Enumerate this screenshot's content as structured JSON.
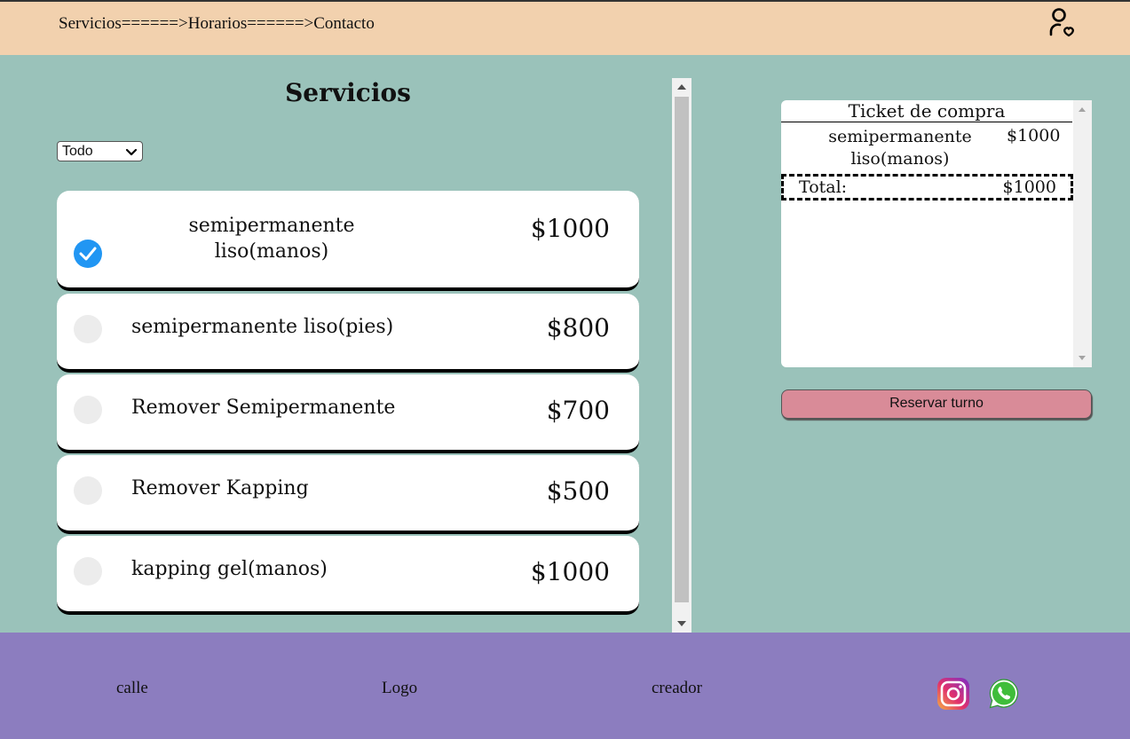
{
  "nav": {
    "items": [
      "Servicios",
      "======>",
      "Horarios",
      "======>",
      "Contacto"
    ]
  },
  "main": {
    "title": "Servicios",
    "filter": {
      "selected": "Todo"
    },
    "services": [
      {
        "name_line1": "semipermanente",
        "name_line2": "liso(manos)",
        "price": "$1000",
        "checked": true
      },
      {
        "name": "semipermanente liso(pies)",
        "price": "$800",
        "checked": false
      },
      {
        "name": "Remover Semipermanente",
        "price": "$700",
        "checked": false
      },
      {
        "name": "Remover Kapping",
        "price": "$500",
        "checked": false
      },
      {
        "name": "kapping gel(manos)",
        "price": "$1000",
        "checked": false
      }
    ]
  },
  "ticket": {
    "title": "Ticket de compra",
    "item_name_line1": "semipermanente",
    "item_name_line2": "liso(manos)",
    "item_price": "$1000",
    "total_label": "Total:",
    "total_value": "$1000"
  },
  "reserve": {
    "label": "Reservar turno"
  },
  "footer": {
    "left": "calle",
    "center": "Logo",
    "right": "creador"
  },
  "colors": {
    "header": "#f2d1ae",
    "background": "#9ac2ba",
    "footer": "#8c7dbf",
    "reserve_button": "#d98b98",
    "check_accent": "#2196f3"
  },
  "icons": [
    "user-icon",
    "chevron-down-icon",
    "check-icon",
    "instagram-icon",
    "whatsapp-icon"
  ]
}
